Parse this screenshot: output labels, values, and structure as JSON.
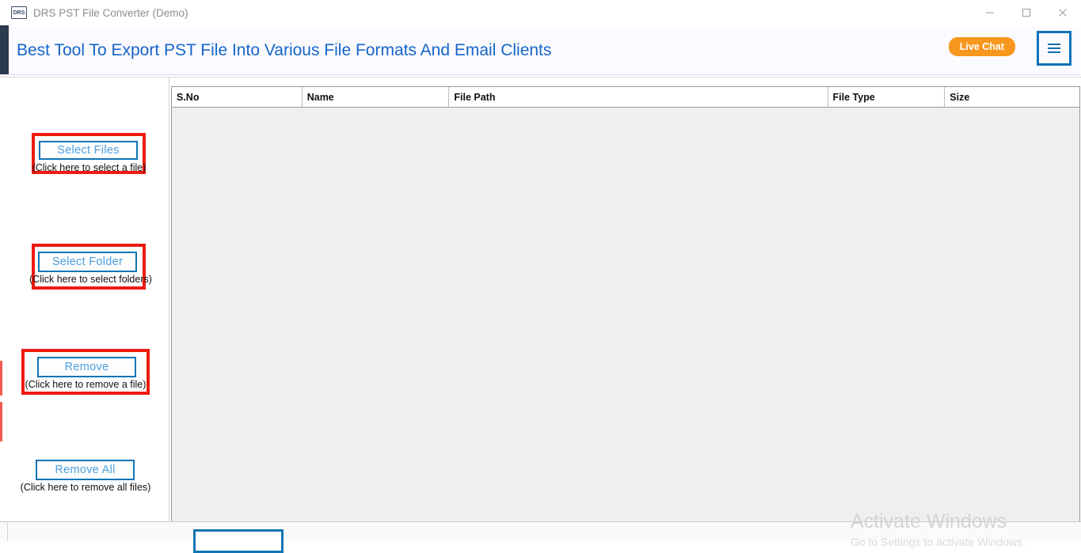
{
  "window": {
    "title": "DRS PST File Converter (Demo)",
    "app_icon": "DRS",
    "controls": {
      "minimize": "minimize-icon",
      "maximize": "maximize-icon",
      "close": "close-icon"
    }
  },
  "banner": {
    "headline": "Best Tool To Export PST File Into Various File Formats And Email Clients",
    "live_chat_label": "Live Chat",
    "menu_icon": "hamburger-icon",
    "headline_color": "#1565c8",
    "live_chat_color": "#f7971e",
    "menu_border_color": "#1072b8"
  },
  "sidebar": {
    "actions": [
      {
        "label": "Select Files",
        "caption": "(Click here to select a file)",
        "highlighted": true
      },
      {
        "label": "Select Folder",
        "caption": "(Click here to select folders)",
        "highlighted": true
      },
      {
        "label": "Remove",
        "caption": "(Click here to remove a file)",
        "highlighted": true
      },
      {
        "label": "Remove All",
        "caption": "(Click here to remove all files)",
        "highlighted": false
      }
    ],
    "button_border_color": "#1275b5",
    "button_text_color": "#4a9fe0",
    "highlight_color": "#ee1b11"
  },
  "file_table": {
    "columns": [
      "S.No",
      "Name",
      "File Path",
      "File Type",
      "Size"
    ],
    "rows": []
  },
  "watermark": {
    "title": "Activate Windows",
    "subtitle": "Go to Settings to activate Windows."
  }
}
